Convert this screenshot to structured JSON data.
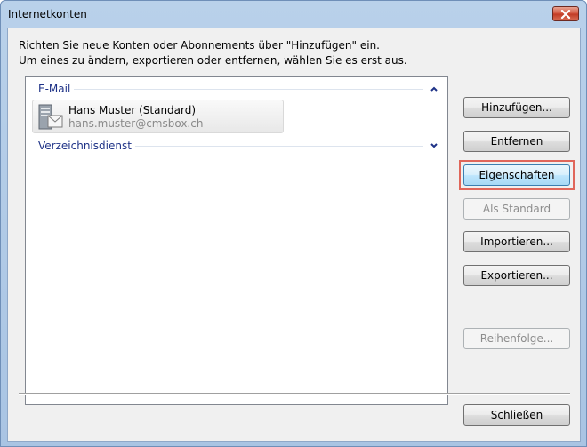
{
  "window": {
    "title": "Internetkonten"
  },
  "instructions": {
    "line1": "Richten Sie neue Konten oder Abonnements über \"Hinzufügen\" ein.",
    "line2": "Um eines zu ändern, exportieren oder entfernen, wählen Sie es erst aus."
  },
  "list": {
    "groups": [
      {
        "label": "E-Mail",
        "state": "expanded",
        "accounts": [
          {
            "name": "Hans Muster (Standard)",
            "email": "hans.muster@cmsbox.ch",
            "icon": "mail-server-icon"
          }
        ]
      },
      {
        "label": "Verzeichnisdienst",
        "state": "collapsed",
        "accounts": []
      }
    ]
  },
  "buttons": {
    "add": "Hinzufügen...",
    "remove": "Entfernen",
    "properties": "Eigenschaften",
    "set_default": "Als Standard",
    "import": "Importieren...",
    "export": "Exportieren...",
    "order": "Reihenfolge...",
    "close": "Schließen"
  },
  "colors": {
    "focus_highlight": "#e0665a",
    "group_header": "#1e3287",
    "close_button": "#c13a24"
  }
}
